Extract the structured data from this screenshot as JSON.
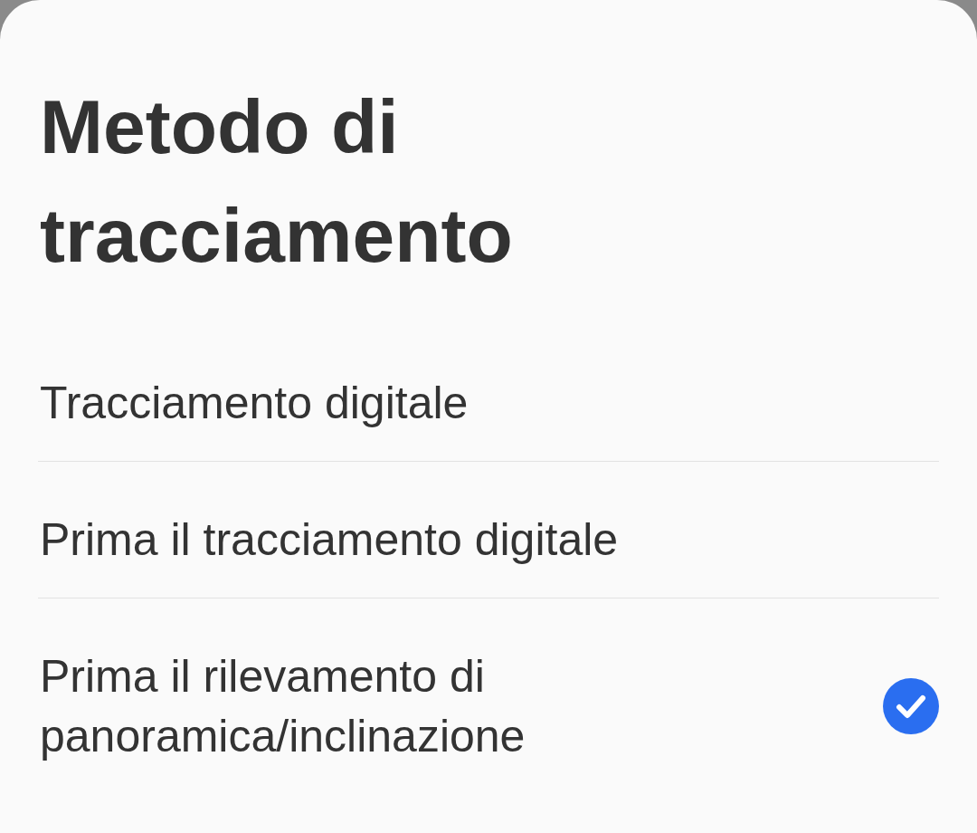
{
  "dialog": {
    "title": "Metodo di tracciamento",
    "options": [
      {
        "label": "Tracciamento digitale",
        "selected": false
      },
      {
        "label": "Prima il tracciamento digitale",
        "selected": false
      },
      {
        "label": "Prima il rilevamento di panoramica/inclinazione",
        "selected": true
      }
    ]
  }
}
